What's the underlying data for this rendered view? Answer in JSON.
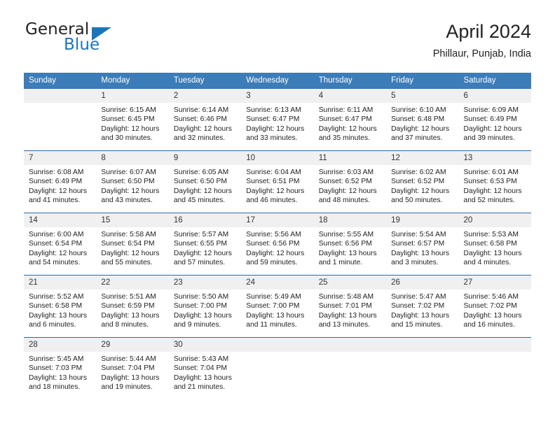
{
  "brand": {
    "name_part1": "General",
    "name_part2": "Blue",
    "logo_icon": "triangle-flag-icon",
    "accent_color": "#1b75bb"
  },
  "header": {
    "title": "April 2024",
    "subtitle": "Phillaur, Punjab, India"
  },
  "theme": {
    "header_row_color": "#3c7cb8",
    "row_divider_color": "#2f6ca6",
    "daynum_band_color": "#f0f0f0",
    "text_color": "#222222"
  },
  "calendar": {
    "weekday_headers": [
      "Sunday",
      "Monday",
      "Tuesday",
      "Wednesday",
      "Thursday",
      "Friday",
      "Saturday"
    ],
    "labels": {
      "sunrise": "Sunrise:",
      "sunset": "Sunset:",
      "daylight": "Daylight:"
    },
    "weeks": [
      [
        {
          "day": "",
          "blank": true,
          "sunrise": "",
          "sunset": "",
          "daylight_1": "",
          "daylight_2": ""
        },
        {
          "day": "1",
          "sunrise": "Sunrise: 6:15 AM",
          "sunset": "Sunset: 6:45 PM",
          "daylight_1": "Daylight: 12 hours",
          "daylight_2": "and 30 minutes."
        },
        {
          "day": "2",
          "sunrise": "Sunrise: 6:14 AM",
          "sunset": "Sunset: 6:46 PM",
          "daylight_1": "Daylight: 12 hours",
          "daylight_2": "and 32 minutes."
        },
        {
          "day": "3",
          "sunrise": "Sunrise: 6:13 AM",
          "sunset": "Sunset: 6:47 PM",
          "daylight_1": "Daylight: 12 hours",
          "daylight_2": "and 33 minutes."
        },
        {
          "day": "4",
          "sunrise": "Sunrise: 6:11 AM",
          "sunset": "Sunset: 6:47 PM",
          "daylight_1": "Daylight: 12 hours",
          "daylight_2": "and 35 minutes."
        },
        {
          "day": "5",
          "sunrise": "Sunrise: 6:10 AM",
          "sunset": "Sunset: 6:48 PM",
          "daylight_1": "Daylight: 12 hours",
          "daylight_2": "and 37 minutes."
        },
        {
          "day": "6",
          "sunrise": "Sunrise: 6:09 AM",
          "sunset": "Sunset: 6:49 PM",
          "daylight_1": "Daylight: 12 hours",
          "daylight_2": "and 39 minutes."
        }
      ],
      [
        {
          "day": "7",
          "sunrise": "Sunrise: 6:08 AM",
          "sunset": "Sunset: 6:49 PM",
          "daylight_1": "Daylight: 12 hours",
          "daylight_2": "and 41 minutes."
        },
        {
          "day": "8",
          "sunrise": "Sunrise: 6:07 AM",
          "sunset": "Sunset: 6:50 PM",
          "daylight_1": "Daylight: 12 hours",
          "daylight_2": "and 43 minutes."
        },
        {
          "day": "9",
          "sunrise": "Sunrise: 6:05 AM",
          "sunset": "Sunset: 6:50 PM",
          "daylight_1": "Daylight: 12 hours",
          "daylight_2": "and 45 minutes."
        },
        {
          "day": "10",
          "sunrise": "Sunrise: 6:04 AM",
          "sunset": "Sunset: 6:51 PM",
          "daylight_1": "Daylight: 12 hours",
          "daylight_2": "and 46 minutes."
        },
        {
          "day": "11",
          "sunrise": "Sunrise: 6:03 AM",
          "sunset": "Sunset: 6:52 PM",
          "daylight_1": "Daylight: 12 hours",
          "daylight_2": "and 48 minutes."
        },
        {
          "day": "12",
          "sunrise": "Sunrise: 6:02 AM",
          "sunset": "Sunset: 6:52 PM",
          "daylight_1": "Daylight: 12 hours",
          "daylight_2": "and 50 minutes."
        },
        {
          "day": "13",
          "sunrise": "Sunrise: 6:01 AM",
          "sunset": "Sunset: 6:53 PM",
          "daylight_1": "Daylight: 12 hours",
          "daylight_2": "and 52 minutes."
        }
      ],
      [
        {
          "day": "14",
          "sunrise": "Sunrise: 6:00 AM",
          "sunset": "Sunset: 6:54 PM",
          "daylight_1": "Daylight: 12 hours",
          "daylight_2": "and 54 minutes."
        },
        {
          "day": "15",
          "sunrise": "Sunrise: 5:58 AM",
          "sunset": "Sunset: 6:54 PM",
          "daylight_1": "Daylight: 12 hours",
          "daylight_2": "and 55 minutes."
        },
        {
          "day": "16",
          "sunrise": "Sunrise: 5:57 AM",
          "sunset": "Sunset: 6:55 PM",
          "daylight_1": "Daylight: 12 hours",
          "daylight_2": "and 57 minutes."
        },
        {
          "day": "17",
          "sunrise": "Sunrise: 5:56 AM",
          "sunset": "Sunset: 6:56 PM",
          "daylight_1": "Daylight: 12 hours",
          "daylight_2": "and 59 minutes."
        },
        {
          "day": "18",
          "sunrise": "Sunrise: 5:55 AM",
          "sunset": "Sunset: 6:56 PM",
          "daylight_1": "Daylight: 13 hours",
          "daylight_2": "and 1 minute."
        },
        {
          "day": "19",
          "sunrise": "Sunrise: 5:54 AM",
          "sunset": "Sunset: 6:57 PM",
          "daylight_1": "Daylight: 13 hours",
          "daylight_2": "and 3 minutes."
        },
        {
          "day": "20",
          "sunrise": "Sunrise: 5:53 AM",
          "sunset": "Sunset: 6:58 PM",
          "daylight_1": "Daylight: 13 hours",
          "daylight_2": "and 4 minutes."
        }
      ],
      [
        {
          "day": "21",
          "sunrise": "Sunrise: 5:52 AM",
          "sunset": "Sunset: 6:58 PM",
          "daylight_1": "Daylight: 13 hours",
          "daylight_2": "and 6 minutes."
        },
        {
          "day": "22",
          "sunrise": "Sunrise: 5:51 AM",
          "sunset": "Sunset: 6:59 PM",
          "daylight_1": "Daylight: 13 hours",
          "daylight_2": "and 8 minutes."
        },
        {
          "day": "23",
          "sunrise": "Sunrise: 5:50 AM",
          "sunset": "Sunset: 7:00 PM",
          "daylight_1": "Daylight: 13 hours",
          "daylight_2": "and 9 minutes."
        },
        {
          "day": "24",
          "sunrise": "Sunrise: 5:49 AM",
          "sunset": "Sunset: 7:00 PM",
          "daylight_1": "Daylight: 13 hours",
          "daylight_2": "and 11 minutes."
        },
        {
          "day": "25",
          "sunrise": "Sunrise: 5:48 AM",
          "sunset": "Sunset: 7:01 PM",
          "daylight_1": "Daylight: 13 hours",
          "daylight_2": "and 13 minutes."
        },
        {
          "day": "26",
          "sunrise": "Sunrise: 5:47 AM",
          "sunset": "Sunset: 7:02 PM",
          "daylight_1": "Daylight: 13 hours",
          "daylight_2": "and 15 minutes."
        },
        {
          "day": "27",
          "sunrise": "Sunrise: 5:46 AM",
          "sunset": "Sunset: 7:02 PM",
          "daylight_1": "Daylight: 13 hours",
          "daylight_2": "and 16 minutes."
        }
      ],
      [
        {
          "day": "28",
          "sunrise": "Sunrise: 5:45 AM",
          "sunset": "Sunset: 7:03 PM",
          "daylight_1": "Daylight: 13 hours",
          "daylight_2": "and 18 minutes."
        },
        {
          "day": "29",
          "sunrise": "Sunrise: 5:44 AM",
          "sunset": "Sunset: 7:04 PM",
          "daylight_1": "Daylight: 13 hours",
          "daylight_2": "and 19 minutes."
        },
        {
          "day": "30",
          "sunrise": "Sunrise: 5:43 AM",
          "sunset": "Sunset: 7:04 PM",
          "daylight_1": "Daylight: 13 hours",
          "daylight_2": "and 21 minutes."
        },
        {
          "day": "",
          "blank": true,
          "sunrise": "",
          "sunset": "",
          "daylight_1": "",
          "daylight_2": ""
        },
        {
          "day": "",
          "blank": true,
          "sunrise": "",
          "sunset": "",
          "daylight_1": "",
          "daylight_2": ""
        },
        {
          "day": "",
          "blank": true,
          "sunrise": "",
          "sunset": "",
          "daylight_1": "",
          "daylight_2": ""
        },
        {
          "day": "",
          "blank": true,
          "sunrise": "",
          "sunset": "",
          "daylight_1": "",
          "daylight_2": ""
        }
      ]
    ]
  }
}
